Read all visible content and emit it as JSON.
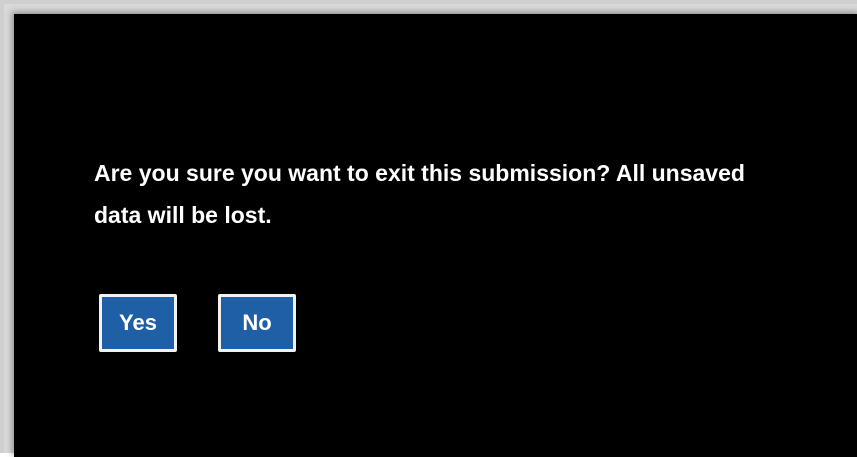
{
  "dialog": {
    "message": "Are you sure you want to exit this submission? All unsaved data will be lost.",
    "yes_label": "Yes",
    "no_label": "No"
  },
  "colors": {
    "dialog_background": "#000000",
    "button_background": "#1f5fa6",
    "button_border": "#f2f2f2",
    "text": "#ffffff"
  }
}
